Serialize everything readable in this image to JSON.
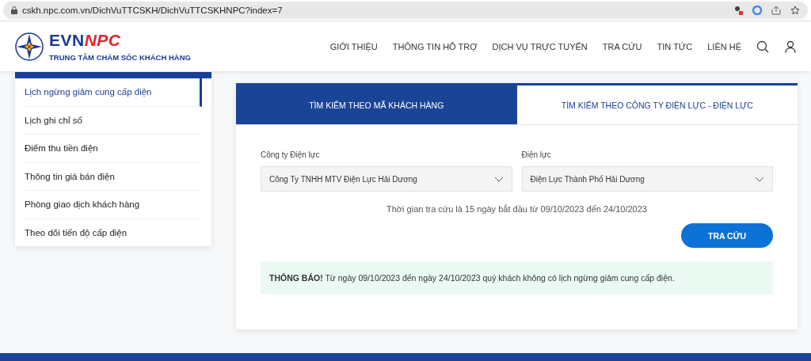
{
  "browser": {
    "url": "cskh.npc.com.vn/DichVuTTCSKH/DichVuTTCSKHNPC?index=7"
  },
  "header": {
    "brand_left": "EVN",
    "brand_right": "NPC",
    "tagline": "TRUNG TÂM CHĂM SÓC KHÁCH HÀNG",
    "nav": [
      "GIỚI THIỆU",
      "THÔNG TIN HỖ TRỢ",
      "DỊCH VỤ TRỰC TUYẾN",
      "TRA CỨU",
      "TIN TỨC",
      "LIÊN HỆ"
    ]
  },
  "sidebar": {
    "items": [
      {
        "label": "Lịch ngừng giảm cung cấp điện",
        "selected": true
      },
      {
        "label": "Lịch ghi chỉ số",
        "selected": false
      },
      {
        "label": "Điểm thu tiền điện",
        "selected": false
      },
      {
        "label": "Thông tin giá bán điện",
        "selected": false
      },
      {
        "label": "Phòng giao dịch khách hàng",
        "selected": false
      },
      {
        "label": "Theo dõi tiến độ cấp điện",
        "selected": false
      }
    ]
  },
  "tabs": [
    {
      "label": "TÌM KIẾM THEO MÃ KHÁCH HÀNG",
      "selected": false
    },
    {
      "label": "TÌM KIẾM THEO CÔNG TY ĐIỆN LỰC - ĐIỆN LỰC",
      "selected": true
    }
  ],
  "form": {
    "fields": [
      {
        "label": "Công ty Điện lực",
        "value": "Công Ty TNHH MTV Điện Lực Hải Dương"
      },
      {
        "label": "Điện lực",
        "value": "Điện Lực Thành Phố Hải Dương"
      }
    ],
    "period": "Thời gian tra cứu là 15 ngày bắt đầu từ 09/10/2023 đến 24/10/2023",
    "button": "TRA CỨU"
  },
  "notice": "**THÔNG BÁO!** Từ ngày 09/10/2023 đến ngày 24/10/2023 quý khách không có lịch ngừng giảm cung cấp điện."
}
